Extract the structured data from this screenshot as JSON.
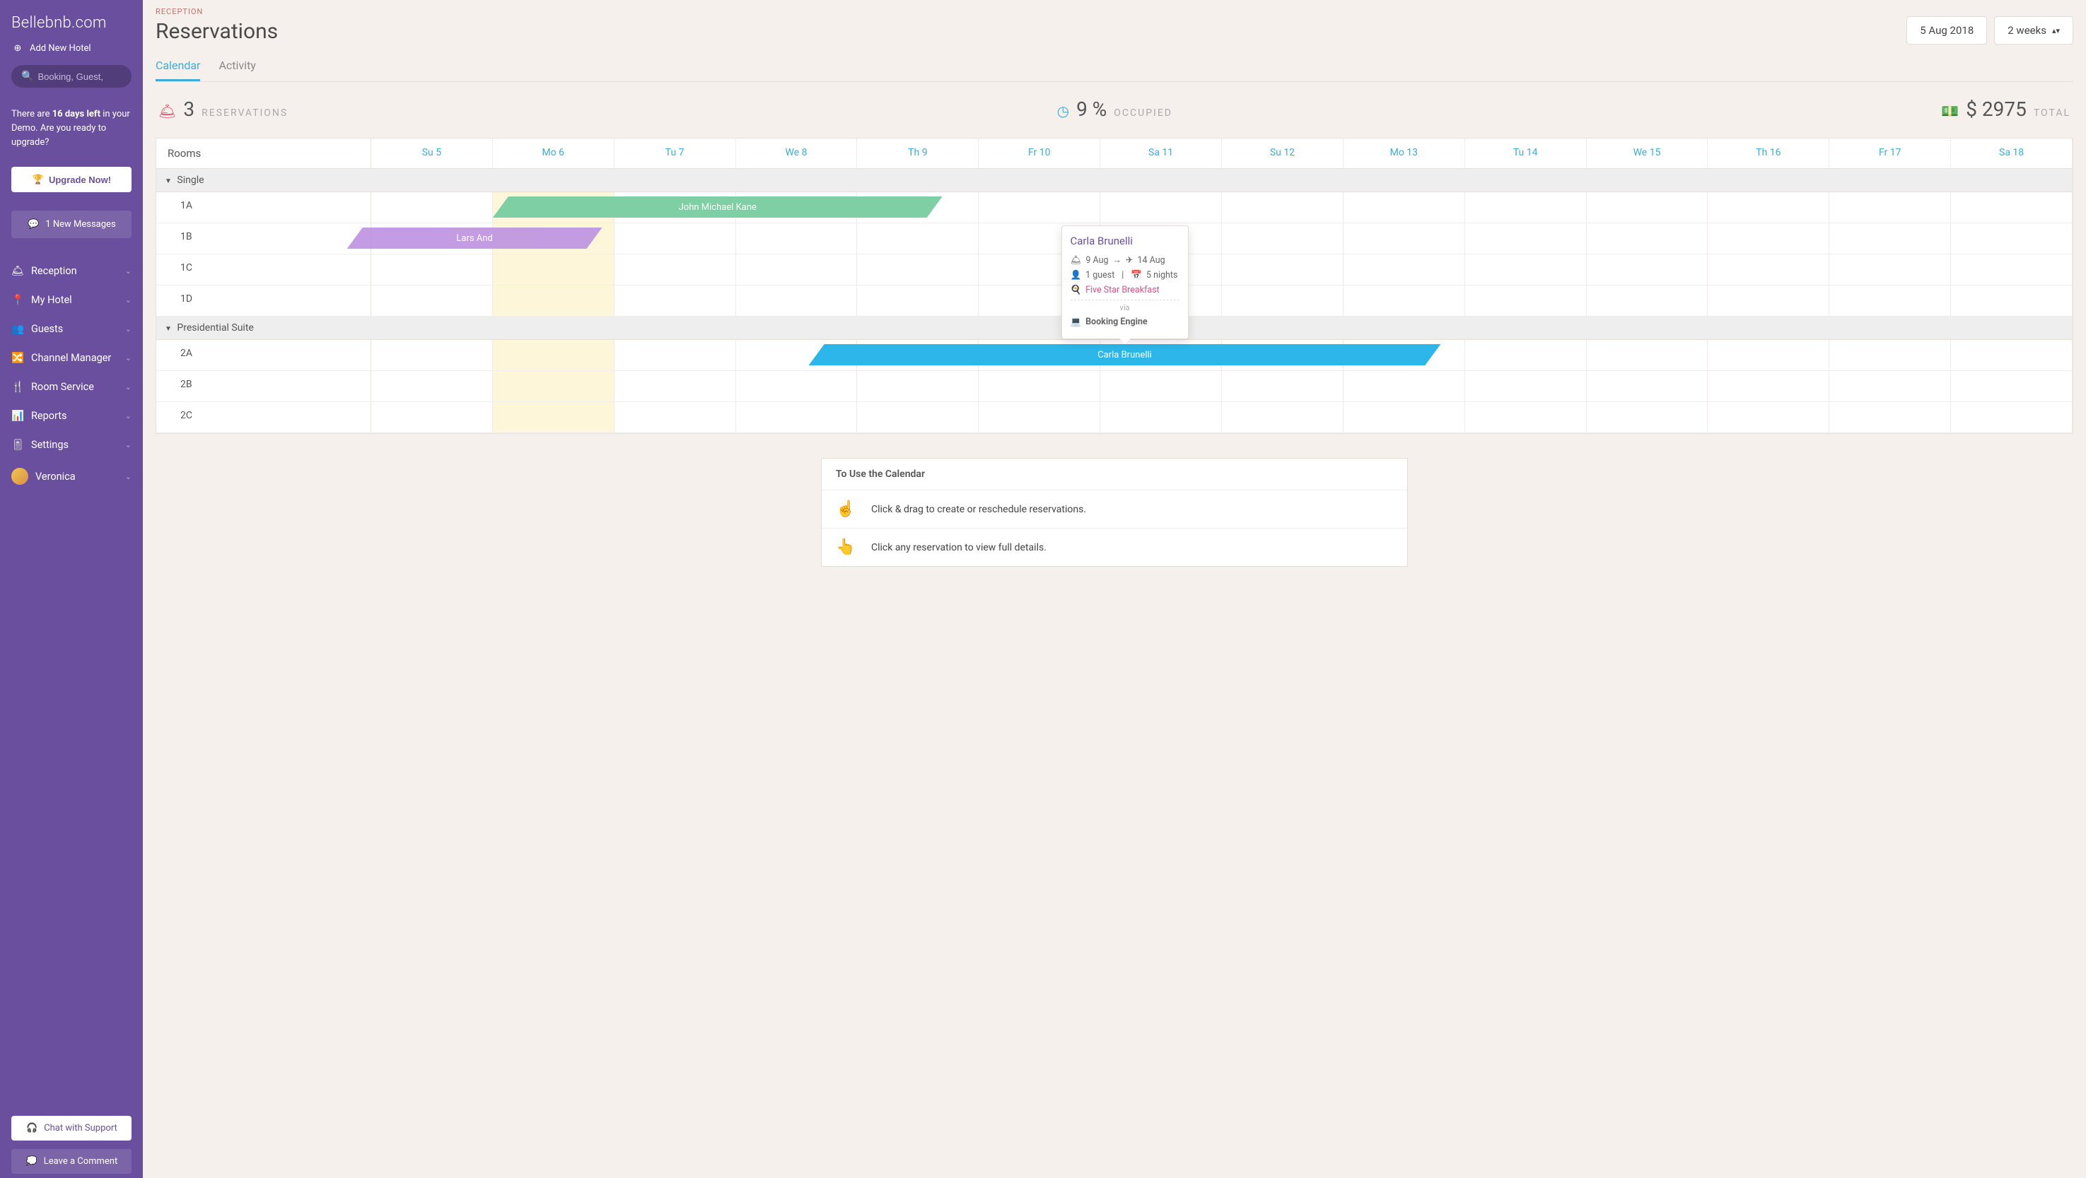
{
  "brand": "Bellebnb.com",
  "sidebar": {
    "add_hotel": "Add New Hotel",
    "search_placeholder": "Booking, Guest,",
    "demo_text_pre": "There are ",
    "demo_days": "16 days left",
    "demo_text_post": " in your Demo. Are you ready to upgrade?",
    "upgrade": "Upgrade Now!",
    "messages": "1 New Messages",
    "items": [
      {
        "label": "Reception"
      },
      {
        "label": "My Hotel"
      },
      {
        "label": "Guests"
      },
      {
        "label": "Channel Manager"
      },
      {
        "label": "Room Service"
      },
      {
        "label": "Reports"
      },
      {
        "label": "Settings"
      },
      {
        "label": "Veronica"
      }
    ],
    "support": "Chat with Support",
    "comment": "Leave a Comment"
  },
  "header": {
    "breadcrumb": "RECEPTION",
    "title": "Reservations",
    "date": "5 Aug 2018",
    "range": "2 weeks"
  },
  "tabs": [
    {
      "label": "Calendar",
      "active": true
    },
    {
      "label": "Activity",
      "active": false
    }
  ],
  "stats": {
    "reservations": {
      "value": "3",
      "label": "RESERVATIONS"
    },
    "occupied": {
      "value": "9 %",
      "label": "OCCUPIED"
    },
    "total": {
      "value": "$ 2975",
      "label": "TOTAL"
    }
  },
  "calendar": {
    "rooms_label": "Rooms",
    "days": [
      "Su 5",
      "Mo 6",
      "Tu 7",
      "We 8",
      "Th 9",
      "Fr 10",
      "Sa 11",
      "Su 12",
      "Mo 13",
      "Tu 14",
      "We 15",
      "Th 16",
      "Fr 17",
      "Sa 18"
    ],
    "today_index": 1,
    "groups": [
      {
        "name": "Single",
        "rooms": [
          "1A",
          "1B",
          "1C",
          "1D"
        ]
      },
      {
        "name": "Presidential Suite",
        "rooms": [
          "2A",
          "2B",
          "2C"
        ]
      }
    ],
    "reservations": [
      {
        "group": 0,
        "room": 0,
        "start": 1.0,
        "span": 3.7,
        "color": "green",
        "guest": "John Michael Kane"
      },
      {
        "group": 0,
        "room": 1,
        "start": -0.2,
        "span": 2.1,
        "color": "purple",
        "guest": "Lars And"
      },
      {
        "group": 1,
        "room": 0,
        "start": 3.6,
        "span": 5.2,
        "color": "blue",
        "guest": "Carla Brunelli"
      }
    ]
  },
  "tooltip": {
    "name": "Carla Brunelli",
    "check_in": "9 Aug",
    "check_out": "14 Aug",
    "guests": "1 guest",
    "nights": "5 nights",
    "meal": "Five Star Breakfast",
    "via": "via",
    "source": "Booking Engine"
  },
  "help": {
    "title": "To Use the Calendar",
    "tips": [
      "Click & drag to create or reschedule reservations.",
      "Click any reservation to view full details."
    ]
  }
}
